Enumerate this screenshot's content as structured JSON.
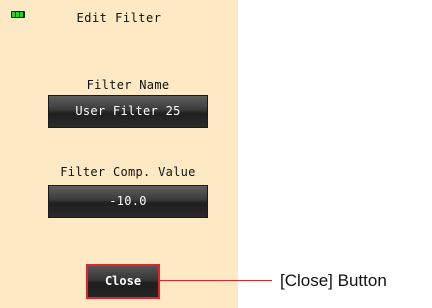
{
  "screen": {
    "title": "Edit Filter",
    "background_color": "#fde9c4",
    "battery_icon": "battery-icon"
  },
  "filter_name": {
    "label": "Filter Name",
    "value": "User Filter 25"
  },
  "filter_comp_value": {
    "label": "Filter Comp. Value",
    "value": "-10.0"
  },
  "close_button": {
    "label": "Close",
    "highlight_color": "#e0242a"
  },
  "callout": {
    "text": "[Close] Button"
  }
}
